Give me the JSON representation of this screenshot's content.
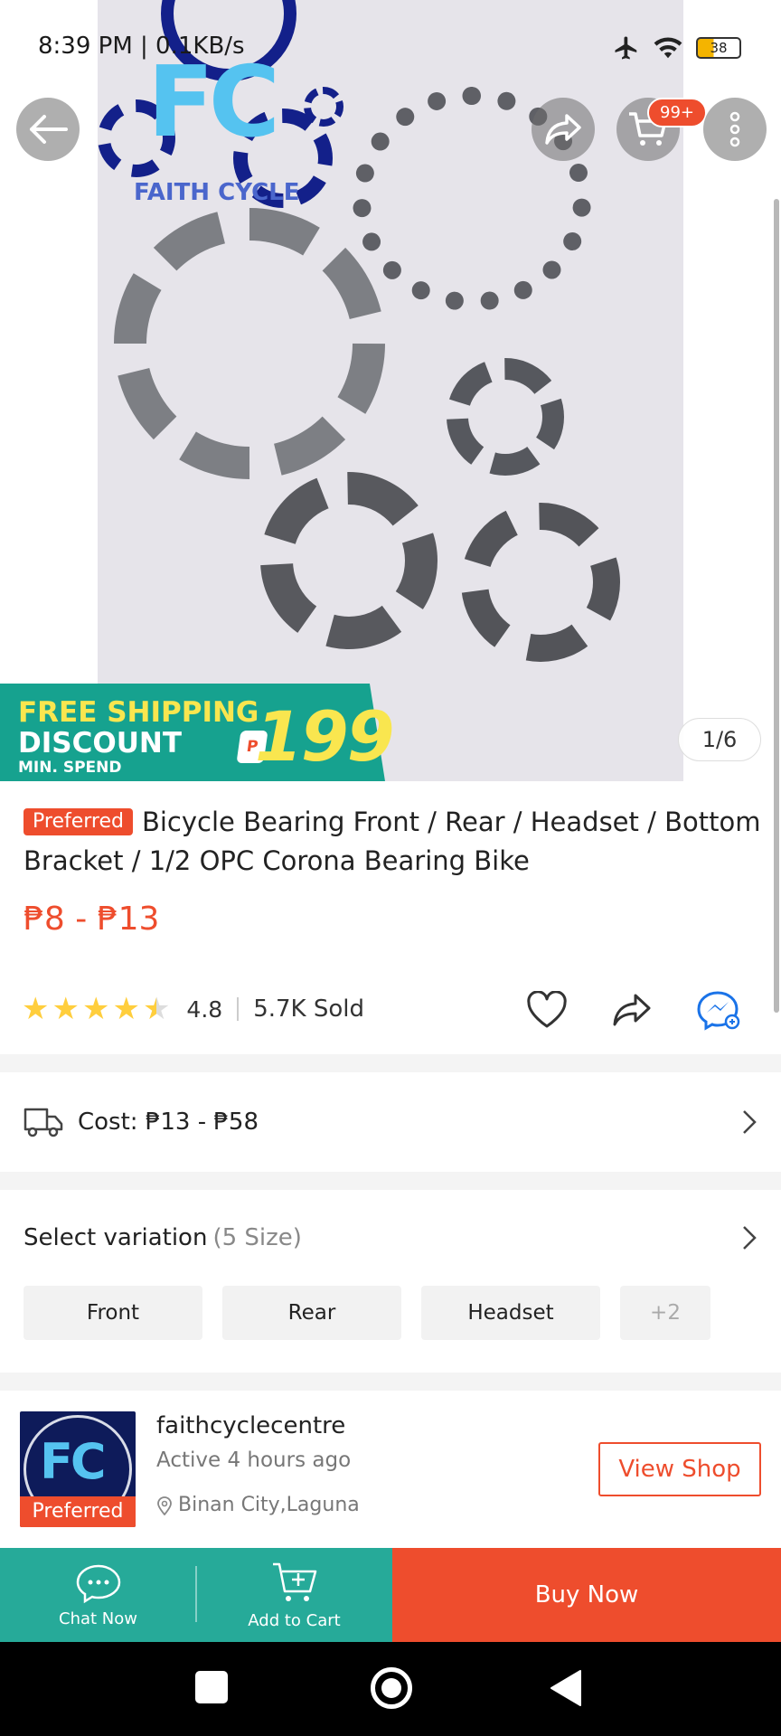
{
  "status_bar": {
    "time": "8:39 PM | 0.1KB/s",
    "battery": "38"
  },
  "hero": {
    "logo_text": "FC",
    "logo_name": "FAITH CYCLE",
    "cart_badge": "99+",
    "image_counter": "1/6",
    "shipping_banner": {
      "line1": "FREE SHIPPING",
      "line2": "DISCOUNT",
      "line3": "MIN. SPEND",
      "currency": "P",
      "amount": "199"
    }
  },
  "product": {
    "badge": "Preferred",
    "title": "Bicycle Bearing Front / Rear / Headset / Bottom Bracket / 1/2 OPC Corona Bearing Bike",
    "price": "₱8 - ₱13",
    "rating": "4.8",
    "rating_fraction": 0.96,
    "sold": "5.7K Sold"
  },
  "shipping": {
    "cost_label": "Cost: ₱13 - ₱58"
  },
  "variation": {
    "label": "Select variation",
    "count": "(5 Size)",
    "options": [
      "Front",
      "Rear",
      "Headset"
    ],
    "more": "+2"
  },
  "shop": {
    "name": "faithcyclecentre",
    "active": "Active 4 hours ago",
    "location": "Binan City,Laguna",
    "avatar_text": "FC",
    "badge": "Preferred",
    "view_button": "View Shop"
  },
  "bottom_bar": {
    "chat": "Chat Now",
    "add_to_cart": "Add to Cart",
    "buy_now": "Buy Now"
  },
  "colors": {
    "brand": "#ee4d2d",
    "teal": "#26aa99",
    "star": "#ffce3d"
  }
}
